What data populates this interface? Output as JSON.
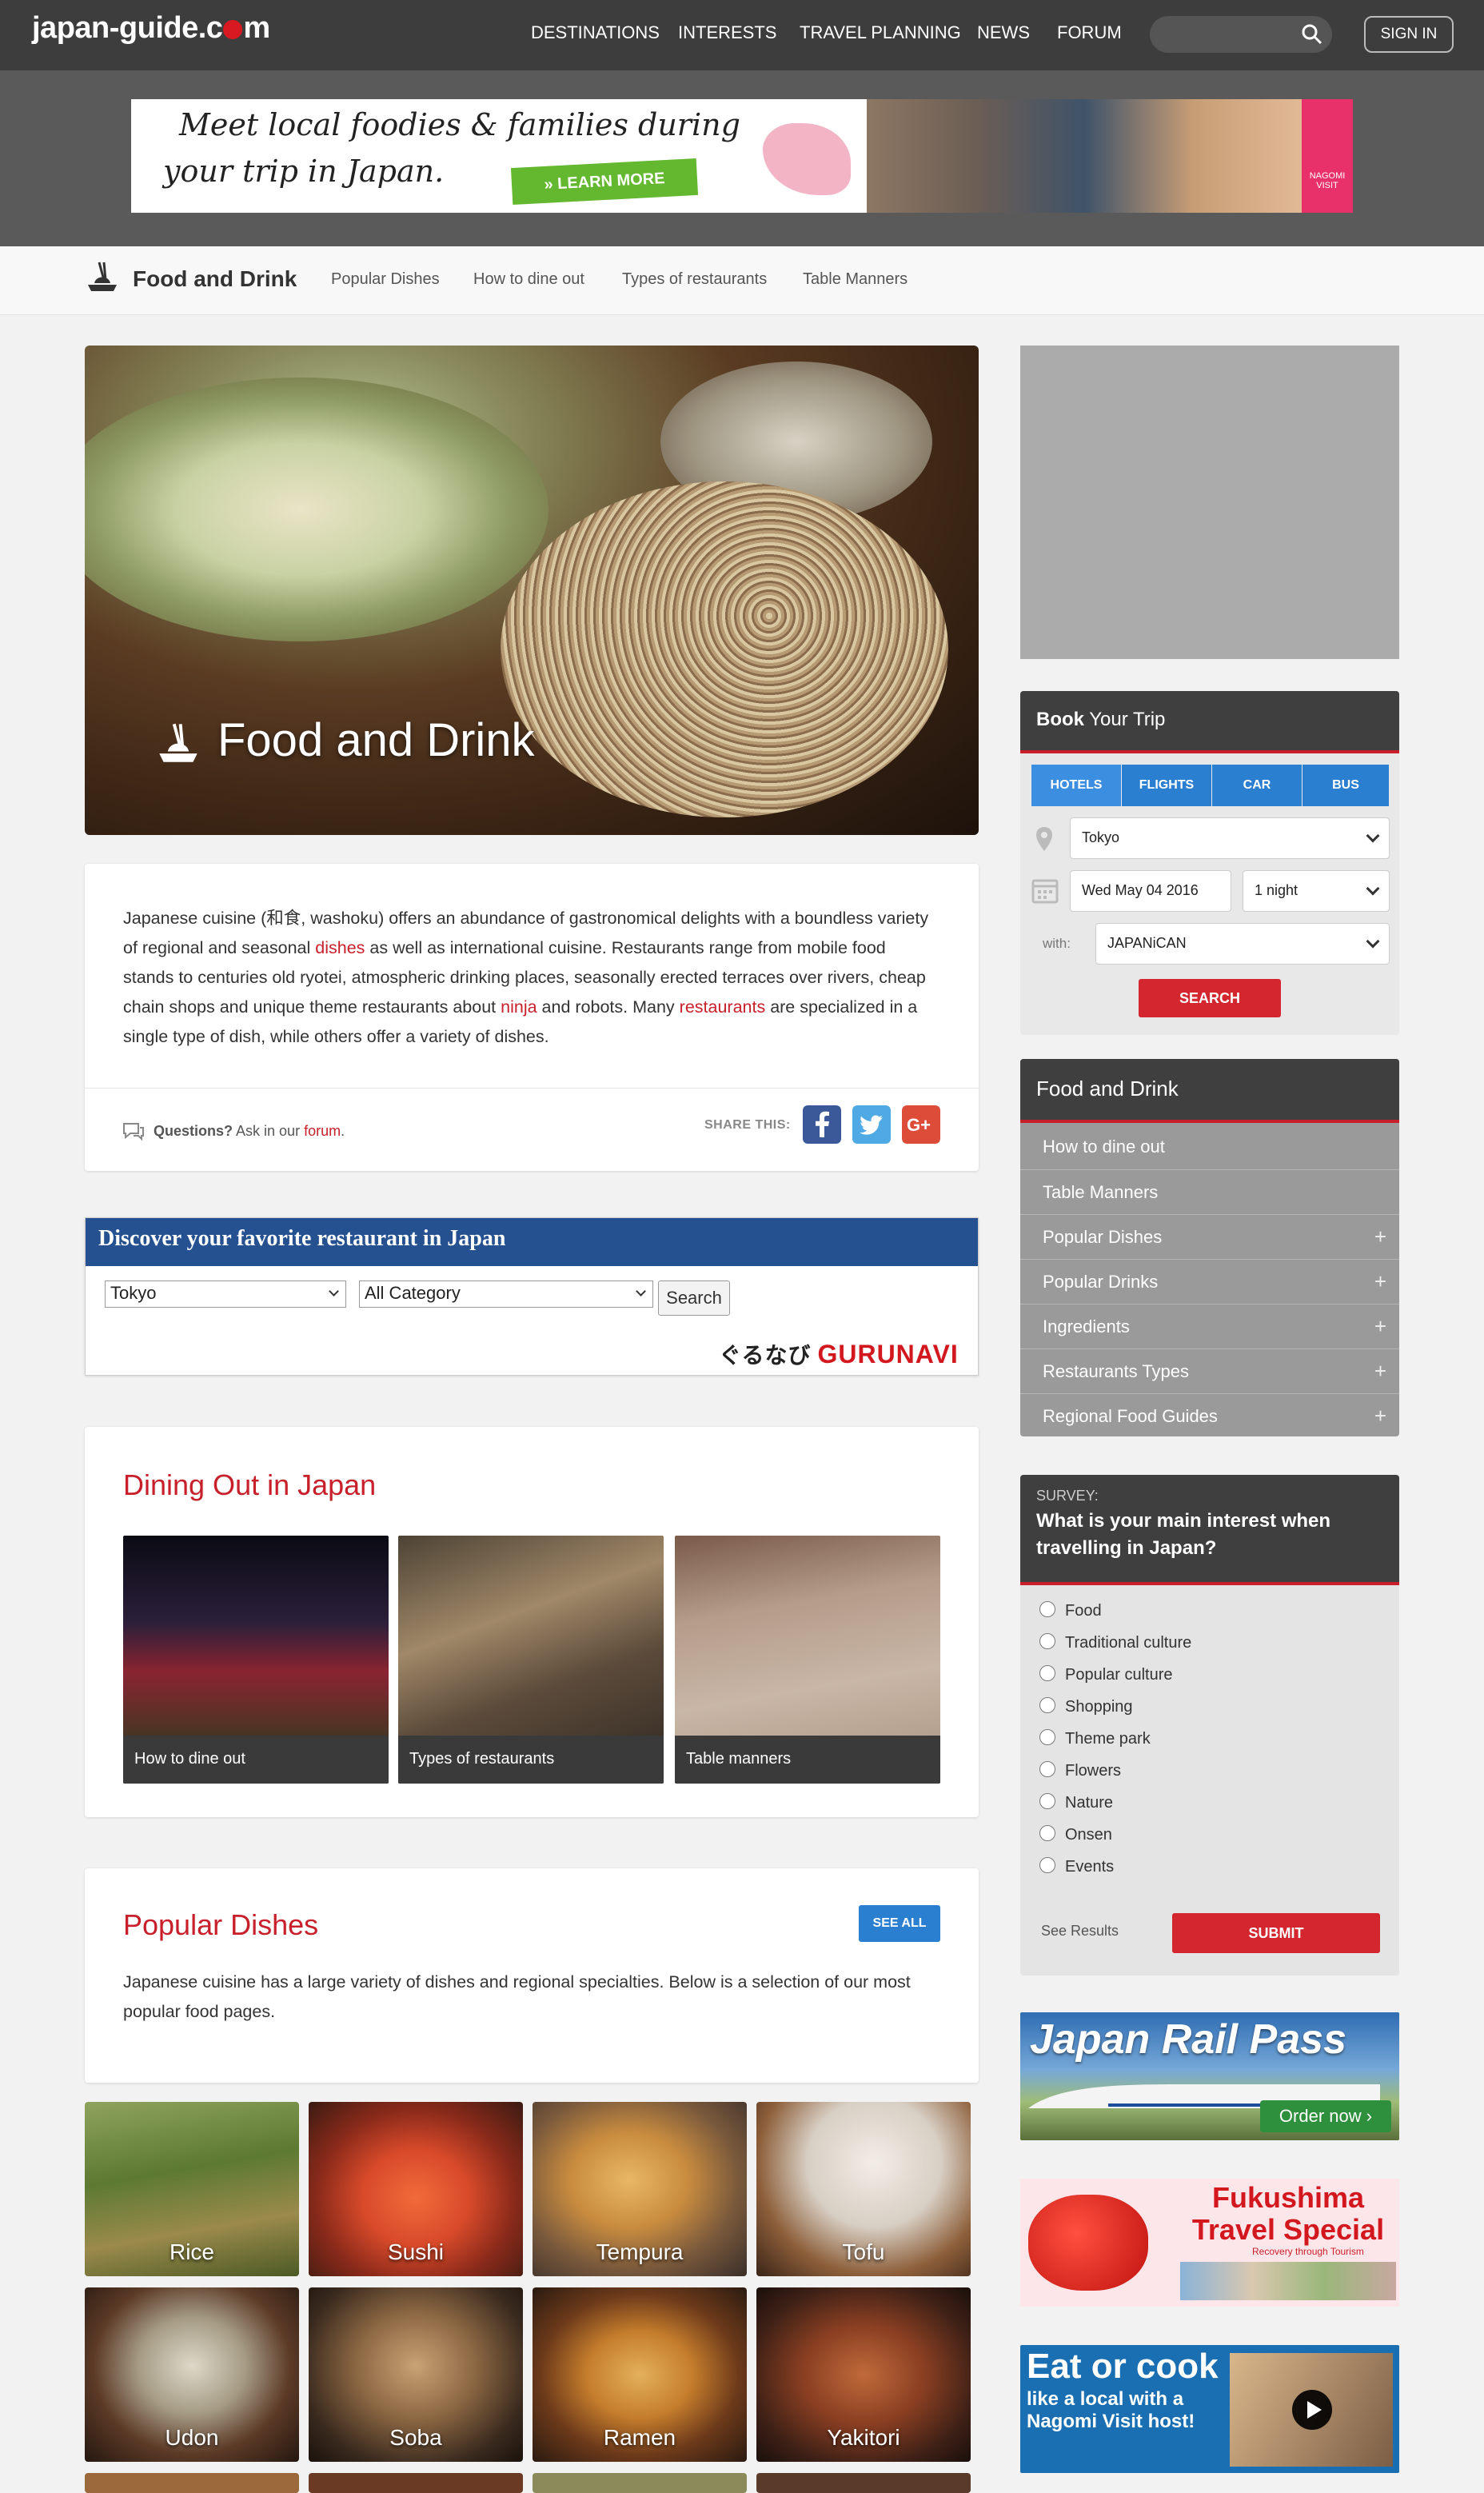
{
  "header": {
    "logo": "japan-guide.com",
    "logo_pre": "japan-guide.c",
    "logo_post": "m",
    "nav": [
      "DESTINATIONS",
      "INTERESTS",
      "TRAVEL PLANNING",
      "NEWS",
      "FORUM"
    ],
    "search_placeholder": "",
    "signin": "SIGN IN"
  },
  "banner": {
    "line1": "Meet local foodies & families during",
    "line2": "your trip in Japan.",
    "button": "» LEARN MORE",
    "brand": "NAGOMI VISIT"
  },
  "subnav": {
    "title": "Food and Drink",
    "links": [
      "Popular Dishes",
      "How to dine out",
      "Types of restaurants",
      "Table Manners"
    ]
  },
  "hero": {
    "title": "Food and Drink"
  },
  "intro": {
    "p1": "Japanese cuisine (和食, washoku) offers an abundance of gastronomical delights with a boundless variety of regional and seasonal ",
    "link1": "dishes",
    "p2": " as well as international cuisine. Restaurants range from mobile food stands to centuries old ryotei, atmospheric drinking places, seasonally erected terraces over rivers, cheap chain shops and unique theme restaurants about ",
    "link2": "ninja",
    "p3": " and robots. Many ",
    "link3": "restaurants",
    "p4": " are specialized in a single type of dish, while others offer a variety of dishes.",
    "questions_bold": "Questions?",
    "questions_text": " Ask in our ",
    "questions_link": "forum",
    "questions_end": ".",
    "share_label": "SHARE THIS:"
  },
  "gurunavi": {
    "heading": "Discover your favorite restaurant in Japan",
    "area": "Tokyo",
    "category": "All Category",
    "search": "Search",
    "logo_jp": "ぐるなび",
    "logo_en": "GURUNAVI"
  },
  "dining": {
    "title": "Dining Out in Japan",
    "tiles": [
      "How to dine out",
      "Types of restaurants",
      "Table manners"
    ]
  },
  "popular": {
    "title": "Popular Dishes",
    "see_all": "SEE ALL",
    "text": "Japanese cuisine has a large variety of dishes and regional specialties. Below is a selection of our most popular food pages.",
    "dishes": [
      "Rice",
      "Sushi",
      "Tempura",
      "Tofu",
      "Udon",
      "Soba",
      "Ramen",
      "Yakitori"
    ]
  },
  "book": {
    "title_bold": "Book",
    "title_rest": " Your Trip",
    "tabs": [
      "HOTELS",
      "FLIGHTS",
      "CAR",
      "BUS"
    ],
    "location": "Tokyo",
    "date": "Wed May 04 2016",
    "nights": "1 night",
    "with_label": "with:",
    "provider": "JAPANiCAN",
    "search": "SEARCH"
  },
  "fd_menu": {
    "title": "Food and Drink",
    "items": [
      {
        "label": "How to dine out",
        "expand": ""
      },
      {
        "label": "Table Manners",
        "expand": ""
      },
      {
        "label": "Popular Dishes",
        "expand": "+"
      },
      {
        "label": "Popular Drinks",
        "expand": "+"
      },
      {
        "label": "Ingredients",
        "expand": "+"
      },
      {
        "label": "Restaurants Types",
        "expand": "+"
      },
      {
        "label": "Regional Food Guides",
        "expand": "+"
      }
    ]
  },
  "survey": {
    "label": "SURVEY:",
    "question": "What is your main interest when travelling in Japan?",
    "options": [
      "Food",
      "Traditional culture",
      "Popular culture",
      "Shopping",
      "Theme park",
      "Flowers",
      "Nature",
      "Onsen",
      "Events"
    ],
    "see_results": "See Results",
    "submit": "SUBMIT"
  },
  "ads": {
    "jrp_title": "Japan Rail Pass",
    "jrp_order": "Order now ›",
    "fuku_title": "Fukushima Travel Special",
    "fuku_sub": "Recovery through Tourism",
    "eat_title": "Eat or cook",
    "eat_sub": "like a local with a Nagomi Visit host!"
  },
  "colors": {
    "accent_red": "#c8202b",
    "topbar": "#3d3d3d",
    "blue": "#2b7fd0",
    "gurunavi_blue": "#255191"
  }
}
